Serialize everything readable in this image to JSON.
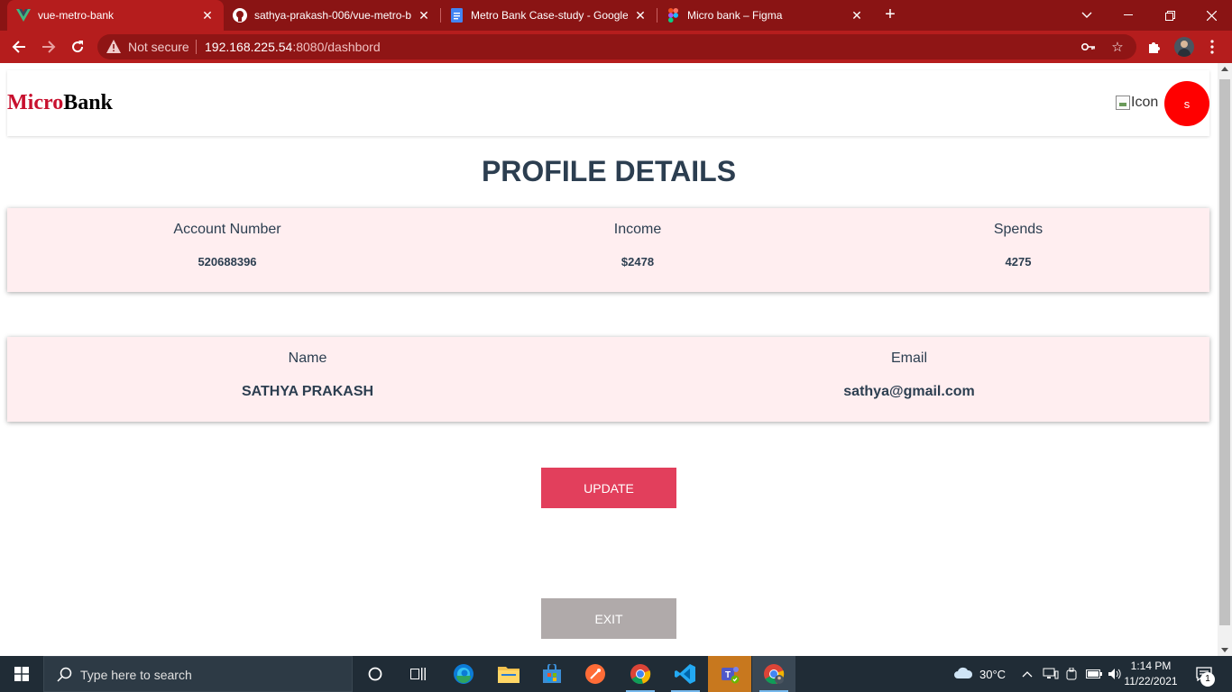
{
  "browser": {
    "tabs": [
      {
        "title": "vue-metro-bank",
        "icon": "vue-icon"
      },
      {
        "title": "sathya-prakash-006/vue-metro-b",
        "icon": "github-icon"
      },
      {
        "title": "Metro Bank Case-study - Google",
        "icon": "docs-icon"
      },
      {
        "title": "Micro bank – Figma",
        "icon": "figma-icon"
      }
    ],
    "security_label": "Not secure",
    "url_host": "192.168.225.54",
    "url_path": ":8080/dashbord"
  },
  "app": {
    "brand_part1": "Micro",
    "brand_part2": "Bank",
    "broken_image_alt": "Icon",
    "avatar_initial": "s",
    "page_title": "PROFILE DETAILS",
    "account": {
      "account_number_label": "Account Number",
      "account_number_value": "520688396",
      "income_label": "Income",
      "income_value": "$2478",
      "spends_label": "Spends",
      "spends_value": "4275"
    },
    "user": {
      "name_label": "Name",
      "name_value": "SATHYA PRAKASH",
      "email_label": "Email",
      "email_value": "sathya@gmail.com"
    },
    "update_label": "UPDATE",
    "exit_label": "EXIT"
  },
  "taskbar": {
    "search_placeholder": "Type here to search",
    "weather": "30°C",
    "time": "1:14 PM",
    "date": "11/22/2021",
    "notifications": "1"
  },
  "colors": {
    "brand_red": "#c8102e",
    "card_bg": "#ffeef0",
    "update_button": "#e23f5c",
    "exit_button": "#b0aaaa",
    "avatar": "#ff0000"
  }
}
